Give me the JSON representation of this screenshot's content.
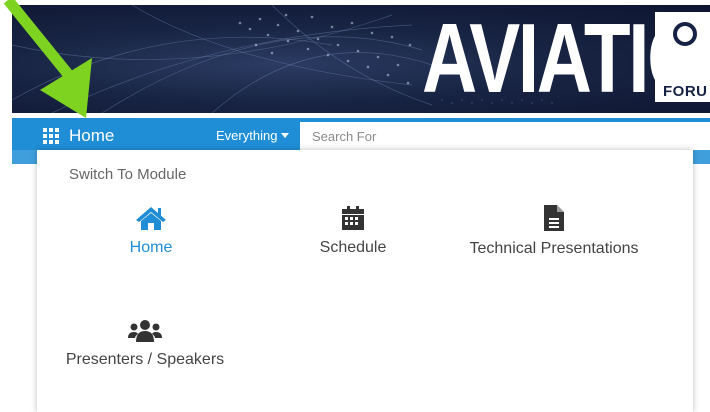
{
  "banner": {
    "logo_text": "AVIATION",
    "logo_suffix": "FORU"
  },
  "nav": {
    "home_label": "Home",
    "filter_label": "Everything",
    "search_placeholder": "Search For"
  },
  "dropdown": {
    "header": "Switch To Module",
    "modules": [
      {
        "label": "Home",
        "icon": "home-icon",
        "active": true
      },
      {
        "label": "Schedule",
        "icon": "calendar-icon",
        "active": false
      },
      {
        "label": "Technical Presentations",
        "icon": "document-icon",
        "active": false
      },
      {
        "label": "Presenters / Speakers",
        "icon": "users-icon",
        "active": false
      }
    ]
  },
  "colors": {
    "nav_blue": "#1f8ed6",
    "nav_blue_light": "#3f9fdc",
    "banner_navy": "#182443",
    "arrow_green": "#7ed321",
    "icon_dark": "#333333"
  }
}
